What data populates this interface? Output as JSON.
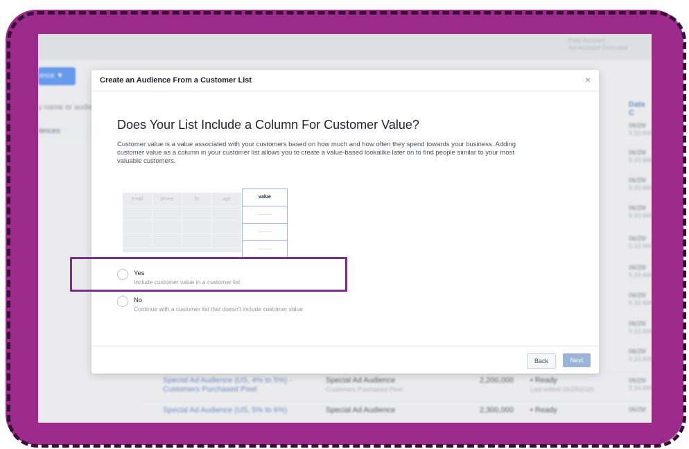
{
  "background": {
    "topbar_right_lines": [
      "Free Account",
      "Ad Account Overview"
    ],
    "create_button_label": "ence ▼",
    "search_hint": "y name or audie",
    "sidebar_item": "iences",
    "date_column_header": "Date C",
    "date_cells": [
      {
        "date": "06/29/",
        "time": "5:33 AM"
      },
      {
        "date": "06/29/",
        "time": "5:33 AM"
      },
      {
        "date": "06/29/",
        "time": "5:33 AM"
      },
      {
        "date": "06/29/",
        "time": "5:33 AM"
      },
      {
        "date": "06/29/",
        "time": "5:33 AM"
      },
      {
        "date": "06/29/",
        "time": "5:33 AM"
      },
      {
        "date": "06/29/",
        "time": "5:33 AM"
      },
      {
        "date": "06/29/",
        "time": "5:33 AM"
      },
      {
        "date": "06/29/",
        "time": "5:33 AM"
      },
      {
        "date": "06/29/",
        "time": "5:34 AM"
      },
      {
        "date": "06/29/",
        "time": ""
      }
    ],
    "rows": [
      {
        "name": "Special Ad Audience (US, 4% to 5%) - Customers Purchased Pixel",
        "type": "Special Ad Audience",
        "type_sub": "Customers Purchased Pixel",
        "size": "2,200,000",
        "status": "• Ready",
        "status_sub": "Last edited 06/29/2020"
      },
      {
        "name": "Special Ad Audience (US, 5% to 6%)",
        "type": "Special Ad Audience",
        "type_sub": "",
        "size": "2,300,000",
        "status": "• Ready",
        "status_sub": ""
      }
    ]
  },
  "modal": {
    "title": "Create an Audience From a Customer List",
    "close_icon": "×",
    "heading": "Does Your List Include a Column For Customer Value?",
    "description": "Customer value is a value associated with your customers based on how much and how often they spend towards your business. Adding customer value as a column in your customer list allows you to create a value-based lookalike later on to find people similar to your most valuable customers.",
    "illustration": {
      "headers": [
        "email",
        "phone",
        "fn",
        "age"
      ],
      "value_header": "value"
    },
    "options": [
      {
        "label": "Yes",
        "sub": "Include customer value in a customer list"
      },
      {
        "label": "No",
        "sub": "Continue with a customer list that doesn't include customer value"
      }
    ],
    "back_label": "Back",
    "next_label": "Next"
  },
  "colors": {
    "frame": "#9b2a8a",
    "highlight": "#7b2d8e",
    "link": "#4267b2",
    "primary_button": "#3578e5"
  }
}
